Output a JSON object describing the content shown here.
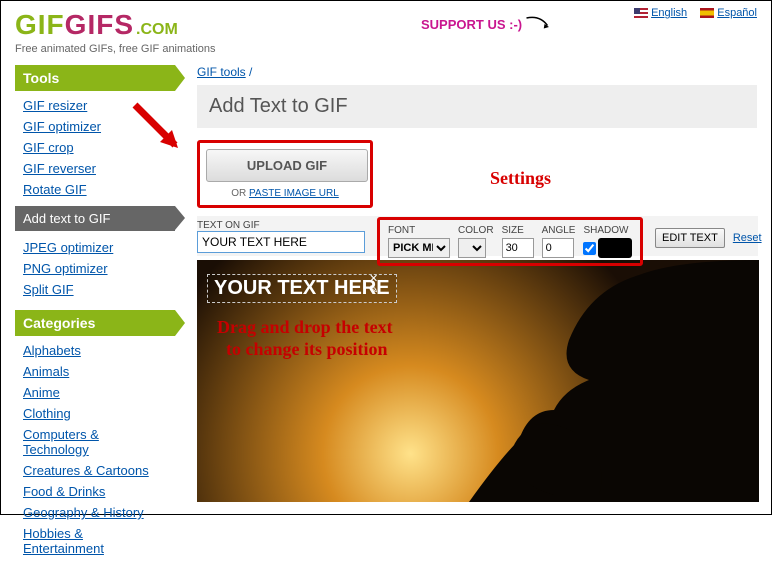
{
  "header": {
    "logo_gif": "GIF",
    "logo_gifs": "GIFS",
    "logo_com": ".COM",
    "tagline": "Free animated GIFs, free GIF animations",
    "support": "SUPPORT US :-)",
    "lang_en": "English",
    "lang_es": "Español"
  },
  "sidebar": {
    "tools_header": "Tools",
    "tools": [
      "GIF resizer",
      "GIF optimizer",
      "GIF crop",
      "GIF reverser",
      "Rotate GIF"
    ],
    "active": "Add text to GIF",
    "tools2": [
      "JPEG optimizer",
      "PNG optimizer",
      "Split GIF"
    ],
    "cat_header": "Categories",
    "cats": [
      "Alphabets",
      "Animals",
      "Anime",
      "Clothing",
      "Computers & Technology",
      "Creatures & Cartoons",
      "Food & Drinks",
      "Geography & History",
      "Hobbies & Entertainment"
    ]
  },
  "breadcrumb": {
    "root": "GIF tools",
    "sep": "/"
  },
  "page_title": "Add Text to GIF",
  "upload": {
    "button": "UPLOAD GIF",
    "or": "OR ",
    "paste": "PASTE IMAGE URL"
  },
  "texton": {
    "label": "TEXT ON GIF",
    "value": "YOUR TEXT HERE"
  },
  "settings": {
    "title": "Settings",
    "font_label": "FONT",
    "font_value": "PICK ME",
    "color_label": "COLOR",
    "size_label": "SIZE",
    "size_value": "30",
    "angle_label": "ANGLE",
    "angle_value": "0",
    "shadow_label": "SHADOW",
    "edit": "EDIT TEXT",
    "reset": "Reset"
  },
  "preview": {
    "overlay": "YOUR TEXT HERE",
    "drag1": "Drag and drop the text",
    "drag2": "to change its position"
  }
}
